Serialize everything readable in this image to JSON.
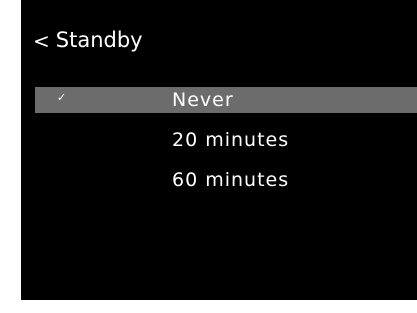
{
  "header": {
    "back_symbol": "<",
    "title": "Standby"
  },
  "menu": {
    "items": [
      {
        "label": "Never",
        "selected": true,
        "check": "✓"
      },
      {
        "label": "20 minutes",
        "selected": false,
        "check": ""
      },
      {
        "label": "60 minutes",
        "selected": false,
        "check": ""
      }
    ]
  },
  "colors": {
    "background": "#000000",
    "text": "#ffffff",
    "selection_highlight": "#6c6c6c"
  },
  "icons": {
    "back": "chevron-left-icon",
    "selected": "checkmark-icon"
  }
}
